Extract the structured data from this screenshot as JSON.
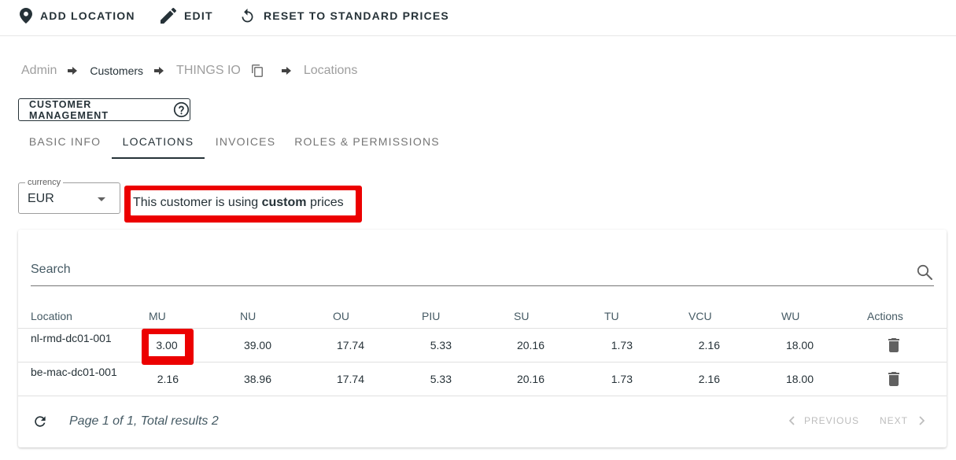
{
  "toolbar": {
    "add_location": "ADD LOCATION",
    "edit": "EDIT",
    "reset": "RESET TO STANDARD PRICES"
  },
  "breadcrumb": {
    "admin": "Admin",
    "customers": "Customers",
    "customer": "THINGS IO",
    "locations": "Locations"
  },
  "customer_management": {
    "label": "CUSTOMER MANAGEMENT"
  },
  "tabs": [
    {
      "label": "BASIC INFO"
    },
    {
      "label": "LOCATIONS"
    },
    {
      "label": "INVOICES"
    },
    {
      "label": "ROLES & PERMISSIONS"
    }
  ],
  "active_tab": "LOCATIONS",
  "currency": {
    "label": "currency",
    "value": "EUR"
  },
  "notice": {
    "prefix": "This customer is using ",
    "emphasis": "custom",
    "suffix": " prices"
  },
  "search": {
    "placeholder": "Search"
  },
  "table": {
    "columns": [
      "Location",
      "MU",
      "NU",
      "OU",
      "PIU",
      "SU",
      "TU",
      "VCU",
      "WU",
      "Actions"
    ],
    "rows": [
      {
        "location": "nl-rmd-dc01-001",
        "values": [
          "3.00",
          "39.00",
          "17.74",
          "5.33",
          "20.16",
          "1.73",
          "2.16",
          "18.00"
        ]
      },
      {
        "location": "be-mac-dc01-001",
        "values": [
          "2.16",
          "38.96",
          "17.74",
          "5.33",
          "20.16",
          "1.73",
          "2.16",
          "18.00"
        ]
      }
    ]
  },
  "pagination": {
    "info": "Page 1 of 1, Total results 2",
    "previous": "PREVIOUS",
    "next": "NEXT"
  },
  "colors": {
    "primary": "#263238",
    "highlight": "#ec0000",
    "muted": "#9e9e9e"
  }
}
